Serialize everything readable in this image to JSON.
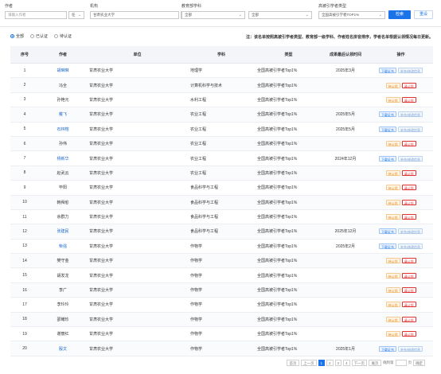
{
  "filters": {
    "author_label": "作者",
    "author_placeholder": "请输入作者",
    "author_select": "任",
    "org_label": "机构",
    "org_value": "甘肃农业大学",
    "org_select": "任",
    "discipline_label": "教育部学科",
    "discipline_value1": "全部",
    "discipline_value2": "全部",
    "highcite_label": "高被引学者类型",
    "highcite_value": "全国高被引学者TOP1%",
    "search_label": "检索",
    "reset_label": "重设"
  },
  "radio": {
    "options": [
      "全部",
      "已认证",
      "待认证"
    ],
    "selected": 0
  },
  "note": "注：该名单按照高被引学者类型、教育部一级学科、作者姓名拼音排序，学者名单根据认领情况每日更新。",
  "table": {
    "headers": [
      "序号",
      "作者",
      "单位",
      "学科",
      "类型",
      "成果最后认领时间",
      "操作"
    ],
    "rows": [
      {
        "no": "1",
        "author": "胡琳琳",
        "unit": "甘肃农业大学",
        "subject": "地理学",
        "type": "全国高被引学者Top1%",
        "time": "2025年3月",
        "ops": [
          "下载证书",
          "补充/修改信息"
        ],
        "link": true
      },
      {
        "no": "2",
        "author": "冯全",
        "unit": "甘肃农业大学",
        "subject": "计算机科学与技术",
        "type": "全国高被引学者Top1%",
        "time": "",
        "ops": [
          "待认领",
          "请认领"
        ],
        "link": false
      },
      {
        "no": "3",
        "author": "孙艳元",
        "unit": "甘肃农业大学",
        "subject": "水利工程",
        "type": "全国高被引学者Top1%",
        "time": "",
        "ops": [
          "待认领",
          "请认领"
        ],
        "link": false
      },
      {
        "no": "4",
        "author": "戴飞",
        "unit": "甘肃农业大学",
        "subject": "农业工程",
        "type": "全国高被引学者Top1%",
        "time": "2025年5月",
        "ops": [
          "下载证书",
          "补充/修改信息"
        ],
        "link": true
      },
      {
        "no": "5",
        "author": "石林榕",
        "unit": "甘肃农业大学",
        "subject": "农业工程",
        "type": "全国高被引学者Top1%",
        "time": "2025年5月",
        "ops": [
          "下载证书",
          "补充/修改信息"
        ],
        "link": true
      },
      {
        "no": "6",
        "author": "孙伟",
        "unit": "甘肃农业大学",
        "subject": "农业工程",
        "type": "全国高被引学者Top1%",
        "time": "",
        "ops": [
          "待认领",
          "请认领"
        ],
        "link": false
      },
      {
        "no": "7",
        "author": "杨新华",
        "unit": "甘肃农业大学",
        "subject": "农业工程",
        "type": "全国高被引学者Top1%",
        "time": "2024年12月",
        "ops": [
          "下载证书",
          "补充/修改信息"
        ],
        "link": true
      },
      {
        "no": "8",
        "author": "赵武云",
        "unit": "甘肃农业大学",
        "subject": "农业工程",
        "type": "全国高被引学者Top1%",
        "time": "",
        "ops": [
          "待认领",
          "请认领"
        ],
        "link": false
      },
      {
        "no": "9",
        "author": "毕阳",
        "unit": "甘肃农业大学",
        "subject": "食品科学与工程",
        "type": "全国高被引学者Top1%",
        "time": "",
        "ops": [
          "待认领",
          "请认领"
        ],
        "link": false
      },
      {
        "no": "10",
        "author": "韩舜愈",
        "unit": "甘肃农业大学",
        "subject": "食品科学与工程",
        "type": "全国高被引学者Top1%",
        "time": "",
        "ops": [
          "待认领",
          "请认领"
        ],
        "link": false
      },
      {
        "no": "11",
        "author": "余群力",
        "unit": "甘肃农业大学",
        "subject": "食品科学与工程",
        "type": "全国高被引学者Top1%",
        "time": "",
        "ops": [
          "待认领",
          "请认领"
        ],
        "link": false
      },
      {
        "no": "12",
        "author": "张建民",
        "unit": "甘肃农业大学",
        "subject": "食品科学与工程",
        "type": "全国高被引学者Top1%",
        "time": "2025年12月",
        "ops": [
          "下载证书",
          "补充/修改信息"
        ],
        "link": true
      },
      {
        "no": "13",
        "author": "柴强",
        "unit": "甘肃农业大学",
        "subject": "作物学",
        "type": "全国高被引学者Top1%",
        "time": "2025年2月",
        "ops": [
          "下载证书",
          "补充/修改信息"
        ],
        "link": true
      },
      {
        "no": "14",
        "author": "樊守金",
        "unit": "甘肃农业大学",
        "subject": "作物学",
        "type": "全国高被引学者Top1%",
        "time": "",
        "ops": [
          "待认领",
          "请认领"
        ],
        "link": false
      },
      {
        "no": "15",
        "author": "胡发龙",
        "unit": "甘肃农业大学",
        "subject": "作物学",
        "type": "全国高被引学者Top1%",
        "time": "",
        "ops": [
          "待认领",
          "请认领"
        ],
        "link": false
      },
      {
        "no": "16",
        "author": "李广",
        "unit": "甘肃农业大学",
        "subject": "作物学",
        "type": "全国高被引学者Top1%",
        "time": "",
        "ops": [
          "待认领",
          "请认领"
        ],
        "link": false
      },
      {
        "no": "17",
        "author": "李玲玲",
        "unit": "甘肃农业大学",
        "subject": "作物学",
        "type": "全国高被引学者Top1%",
        "time": "",
        "ops": [
          "待认领",
          "请认领"
        ],
        "link": false
      },
      {
        "no": "18",
        "author": "邵耀珍",
        "unit": "甘肃农业大学",
        "subject": "作物学",
        "type": "全国高被引学者Top1%",
        "time": "",
        "ops": [
          "待认领",
          "请认领"
        ],
        "link": false
      },
      {
        "no": "19",
        "author": "谢丽红",
        "unit": "甘肃农业大学",
        "subject": "作物学",
        "type": "全国高被引学者Top1%",
        "time": "",
        "ops": [
          "待认领",
          "请认领"
        ],
        "link": false
      },
      {
        "no": "20",
        "author": "殷文",
        "unit": "甘肃农业大学",
        "subject": "作物学",
        "type": "全国高被引学者Top1%",
        "time": "2025年1月",
        "ops": [
          "下载证书",
          "补充/修改信息"
        ],
        "link": true
      }
    ]
  },
  "pager": {
    "first": "首页",
    "prev": "上一页",
    "pages": [
      "1",
      "2",
      "3",
      "4"
    ],
    "active": 0,
    "next": "下一页",
    "last": "尾页",
    "jump_placeholder": "确到第",
    "page_unit": "页",
    "go": "确定"
  },
  "colors": {
    "primary": "#1a73e8",
    "claim_red": "#e0312f",
    "pending_orange": "#e88a1a"
  }
}
